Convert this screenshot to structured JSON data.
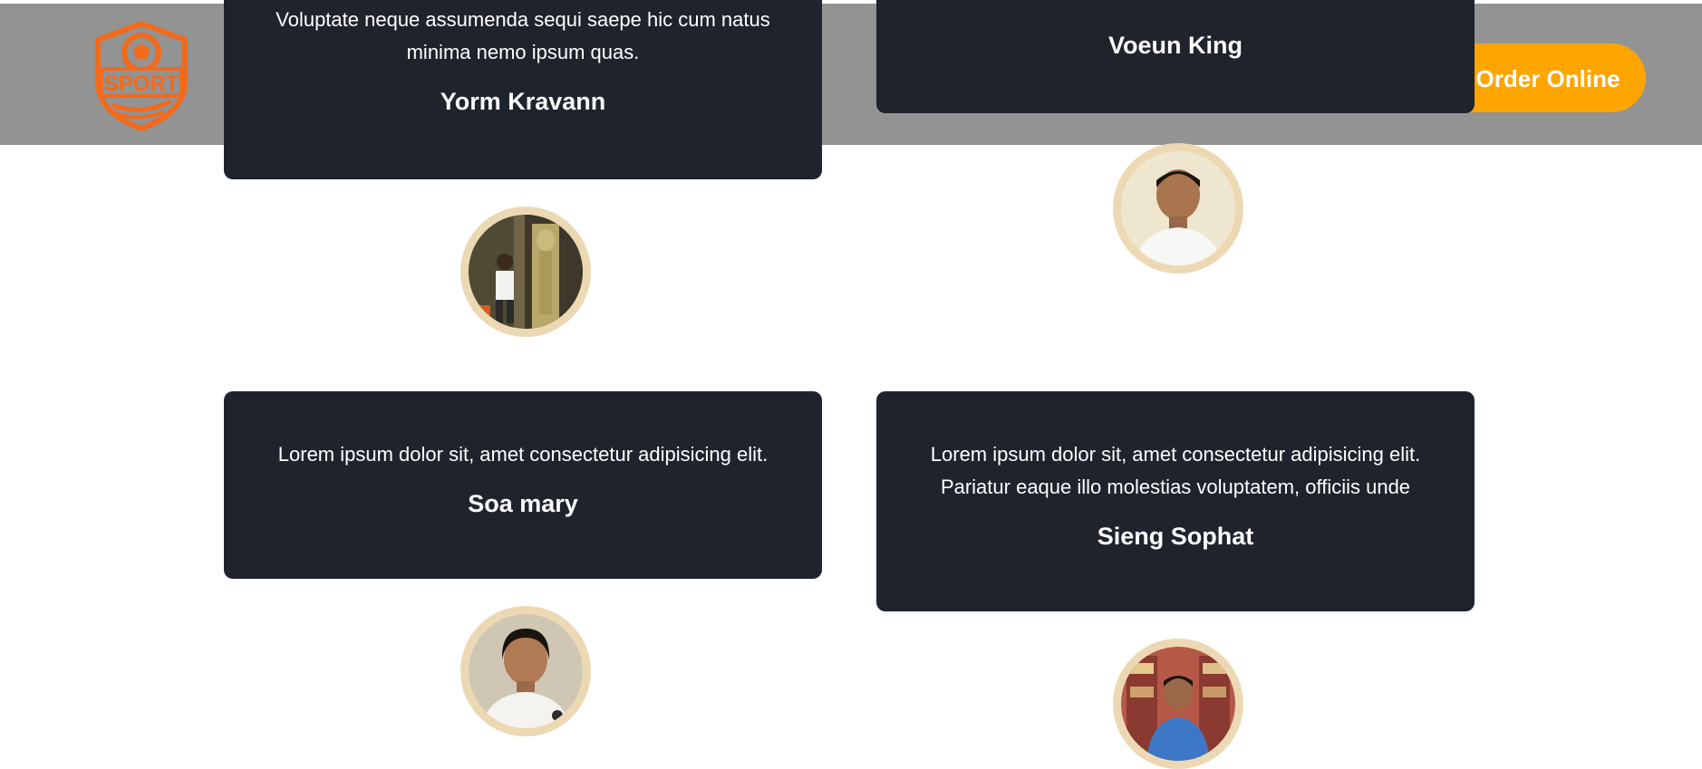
{
  "header": {
    "logo_text": "SPORT",
    "order_label": "Order Online",
    "accent": "#ffa500",
    "logo_color": "#f26a1b"
  },
  "testimonials": [
    {
      "text_lines": [
        "Voluptate neque assumenda sequi saepe hic cum natus",
        "minima nemo ipsum quas."
      ],
      "name": "Yorm Kravann"
    },
    {
      "text_lines": [],
      "name": "Voeun King"
    },
    {
      "text_lines": [
        "Lorem ipsum dolor sit, amet consectetur adipisicing elit."
      ],
      "name": "Soa mary"
    },
    {
      "text_lines": [
        "Lorem ipsum dolor sit, amet consectetur adipisicing elit.",
        "Pariatur eaque illo molestias voluptatem, officiis unde"
      ],
      "name": "Sieng Sophat"
    }
  ],
  "colors": {
    "card_bg": "#1f242c",
    "avatar_ring": "#ecd9b4",
    "header_bg": "#939393"
  }
}
